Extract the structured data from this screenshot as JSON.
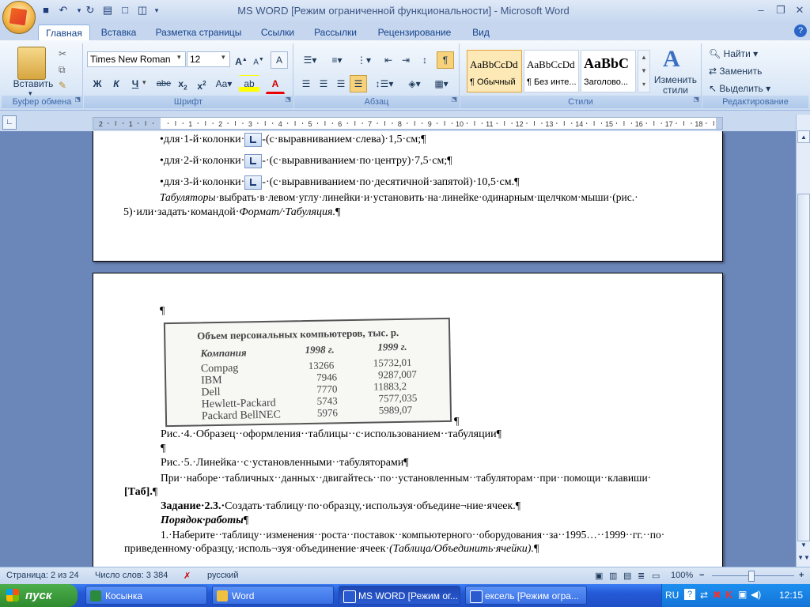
{
  "window": {
    "title": "MS WORD [Режим ограниченной функциональности] - Microsoft Word"
  },
  "tabs": [
    "Главная",
    "Вставка",
    "Разметка страницы",
    "Ссылки",
    "Рассылки",
    "Рецензирование",
    "Вид"
  ],
  "ribbon": {
    "clipboard": {
      "paste": "Вставить",
      "label": "Буфер обмена"
    },
    "font": {
      "name": "Times New Roman",
      "size": "12",
      "label": "Шрифт",
      "bold": "Ж",
      "italic": "К",
      "underline": "Ч",
      "strike": "abe"
    },
    "paragraph": {
      "label": "Абзац"
    },
    "styles": {
      "label": "Стили",
      "change": "Изменить стили",
      "items": [
        {
          "sample": "AaBbCcDd",
          "name": "¶ Обычный"
        },
        {
          "sample": "AaBbCcDd",
          "name": "¶ Без инте..."
        },
        {
          "sample": "AaBbC",
          "name": "Заголово..."
        }
      ]
    },
    "editing": {
      "label": "Редактирование",
      "find": "Найти",
      "replace": "Заменить",
      "select": "Выделить"
    }
  },
  "page1": {
    "line1_a": "•для·1-й·колонки·",
    "line1_b": "-(с·выравниванием·слева)·1,5·см;¶",
    "line2_a": "•для·2-й·колонки·",
    "line2_b": "-·(с·выравниванием·по·центру)·7,5·см;¶",
    "line3_a": "•для·3-й·колонки·",
    "line3_b": "-·(с·выравниванием·по·десятичной·запятой)·10,5·см.¶",
    "para_i1": "Табуляторы",
    "para_t1": "·выбрать·в·левом·углу·линейки·и·установить·на·линейке·одинарным·щелчком·мыши·(рис.·",
    "para2_t": "5)·или·задать·командой·",
    "para2_i": "Формат/·Табуляция.",
    "para2_end": "¶"
  },
  "page2": {
    "pilcrow1": "¶",
    "scan": {
      "title": "Объем персональных компьютеров, тыс. р.",
      "headers": [
        "Компания",
        "1998 г.",
        "1999 г."
      ],
      "rows": [
        [
          "Compag",
          "13266",
          "15732,01"
        ],
        [
          "IBM",
          "7946",
          "9287,007"
        ],
        [
          "Dell",
          "7770",
          "11883,2"
        ],
        [
          "Hewlett-Packard",
          "5743",
          "7577,035"
        ],
        [
          "Packard BellNEC",
          "5976",
          "5989,07"
        ]
      ]
    },
    "pilcrow_after_img": "¶",
    "caption4": "Рис.·4.·Образец··оформления··таблицы··с·использованием··табуляции¶",
    "pilcrow2": "¶",
    "caption5": "Рис.·5.·Линейка··с·установленными··табуляторами¶",
    "para_tab": "При··наборе··табличных··данных··двигайтесь··по··установленным··табуляторам··при··помощи··клавиши·",
    "tab_key": "[Таб].",
    "tab_key_end": "¶",
    "task_bold": "Задание·2.3.·",
    "task_text": "Создать·таблицу·по·образцу,·используя·объедине¬ние·ячеек.¶",
    "procedure": "Порядок·работы",
    "procedure_end": "¶",
    "step1_a": "1.·Наберите··таблицу··изменения··роста··поставок··компьютерного··оборудования··за··1995…··1999··гг.··по·",
    "step1_b": "приведенному·образцу,·исполь¬зуя·объединение·ячеек·",
    "step1_i": "(Таблица/Объединить·ячейки).",
    "step1_end": "¶"
  },
  "status": {
    "page": "Страница: 2 из 24",
    "words": "Число слов: 3 384",
    "lang": "русский",
    "zoom": "100%"
  },
  "taskbar": {
    "start": "пуск",
    "tasks": [
      "Косынка",
      "Word",
      "MS WORD [Режим ог...",
      "ексель [Режим огра..."
    ],
    "lang": "RU",
    "clock": "12:15"
  }
}
